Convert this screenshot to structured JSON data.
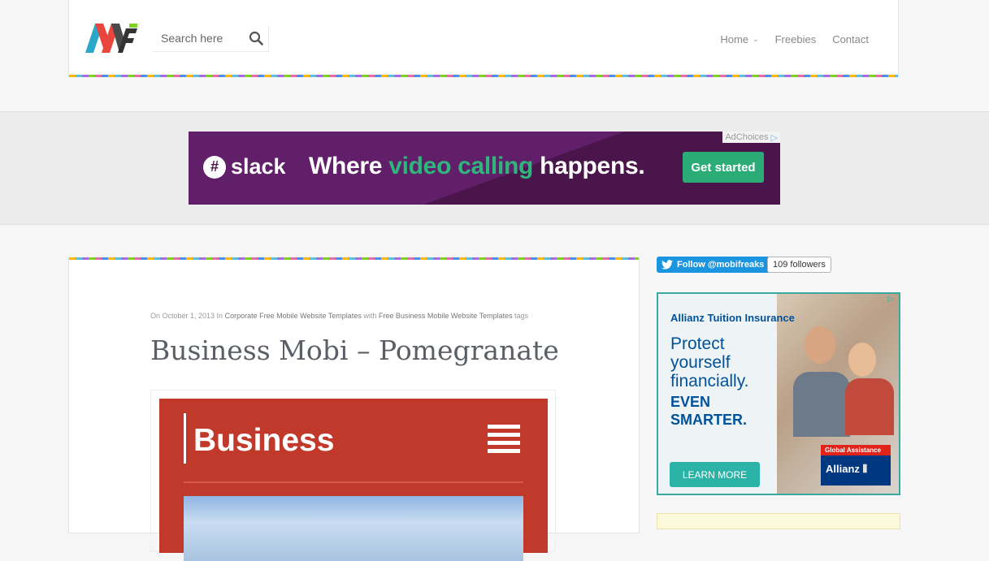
{
  "header": {
    "logo_alt": "MF",
    "search": {
      "placeholder": "Search here",
      "value": ""
    },
    "nav": [
      {
        "label": "Home",
        "has_dropdown": true
      },
      {
        "label": "Freebies",
        "has_dropdown": false
      },
      {
        "label": "Contact",
        "has_dropdown": false
      }
    ]
  },
  "top_ad": {
    "adchoices": "AdChoices",
    "brand": "slack",
    "headline_pre": "Where ",
    "headline_highlight": "video calling",
    "headline_post": " happens.",
    "cta": "Get started",
    "colors": {
      "background": "#4a154b",
      "highlight": "#2eb67d",
      "cta": "#2bac76"
    }
  },
  "post": {
    "meta": {
      "prefix": "On October 1, 2013 In",
      "category": "Corporate Free Mobile Website Templates",
      "with": "with",
      "tags": "Free Business Mobile Website Templates",
      "suffix": "tags"
    },
    "title": "Business Mobi – Pomegranate",
    "thumbnail": {
      "word": "Business",
      "background": "#c0392b"
    }
  },
  "sidebar": {
    "twitter": {
      "follow_label": "Follow @mobifreaks",
      "followers": "109 followers"
    },
    "allianz_ad": {
      "brand": "Allianz Tuition Insurance",
      "line1": [
        "Protect",
        "yourself",
        "financially."
      ],
      "line2": [
        "EVEN",
        "SMARTER."
      ],
      "cta": "LEARN MORE",
      "badge_top": "Global Assistance",
      "badge_name": "Allianz"
    }
  }
}
